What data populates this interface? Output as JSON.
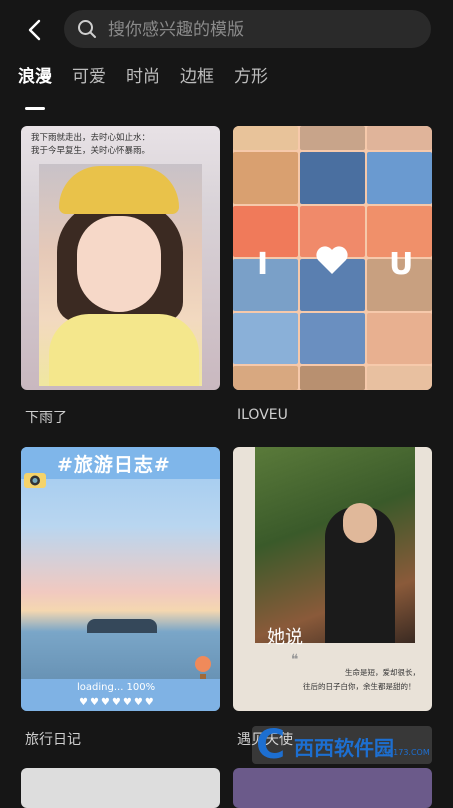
{
  "search": {
    "placeholder": "搜你感兴趣的模版"
  },
  "tabs": [
    {
      "label": "浪漫",
      "active": true
    },
    {
      "label": "可爱"
    },
    {
      "label": "时尚"
    },
    {
      "label": "边框"
    },
    {
      "label": "方形"
    }
  ],
  "templates": [
    {
      "name": "下雨了",
      "caption_line1": "我下雨就走出，去时心如止水：",
      "caption_line2": "我于今早复生，关时心怀暴雨。"
    },
    {
      "name": "ILOVEU",
      "overlay_letters": [
        "I",
        "U"
      ]
    },
    {
      "name": "旅行日记",
      "banner": "#旅游日志#",
      "loading": "loading... 100%",
      "hearts": "♥♥♥♥♥♥♥"
    },
    {
      "name": "遇见天使",
      "photo_text": "她说",
      "poem_line1": "生命是短，爱却很长，",
      "poem_line2": "往后的日子白你，余生都是甜的！"
    }
  ],
  "watermark": {
    "brand": "西西软件园",
    "url": "CR173.COM"
  },
  "colors": {
    "background": "#161616",
    "search_bg": "#2a2a2a",
    "label": "#cfcfcf"
  }
}
